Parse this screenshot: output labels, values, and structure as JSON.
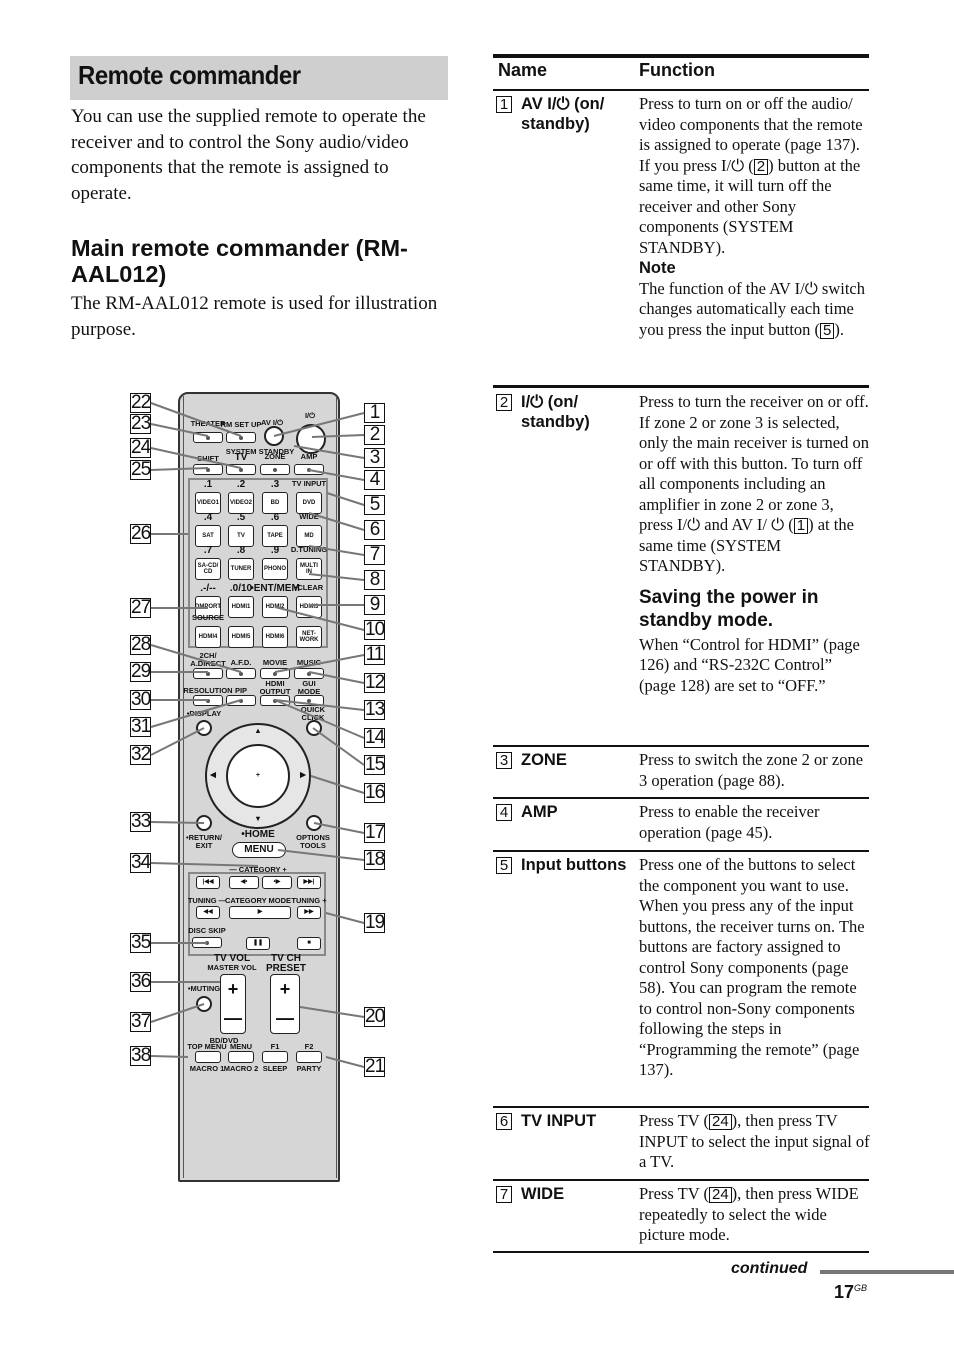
{
  "section_title": "Remote commander",
  "intro": "You can use the supplied remote to operate the receiver and to control the Sony audio/video components that the remote is assigned to operate.",
  "subheading": "Main remote commander (RM-AAL012)",
  "subtext": "The RM-AAL012 remote is used for illustration purpose.",
  "remote": {
    "labels": {
      "theater": "THEATER",
      "rm_set_up": "RM SET UP",
      "av_power": "AV I/⏻",
      "power": "I/⏻",
      "system_standby": "SYSTEM STANDBY",
      "shift": "SHIFT",
      "tv": "TV",
      "zone": "ZONE",
      "amp": "AMP",
      "n1": ".1",
      "n2": ".2",
      "n3": ".3",
      "tv_input": "TV INPUT",
      "n4": ".4",
      "n5": ".5",
      "n6": ".6",
      "wide": "WIDE",
      "n7": ".7",
      "n8": ".8",
      "n9": ".9",
      "d_tuning": "D.TUNING",
      "dash": ".-/--",
      "n0": ".0/10",
      "ent_mem": "•ENT/MEM",
      "clear": "•CLEAR",
      "source": "SOURCE",
      "two_ch": "2CH/\nA.DIRECT",
      "afd": "A.F.D.",
      "movie": "MOVIE",
      "music": "MUSIC",
      "resolution": "RESOLUTION",
      "pip": "PIP",
      "hdmi_output": "HDMI\nOUTPUT",
      "gui_mode": "GUI\nMODE",
      "display": "•DISPLAY",
      "quick_click": "QUICK\nCLICK",
      "return_exit": "•RETURN/\nEXIT",
      "home": "•HOME",
      "menu": "MENU",
      "options_tools": "OPTIONS\nTOOLS",
      "category": "— CATEGORY +",
      "tuning_minus": "TUNING —",
      "category_mode": "CATEGORY MODE",
      "tuning_plus": "TUNING +",
      "disc_skip": "DISC SKIP",
      "tv_vol": "TV VOL",
      "master_vol": "MASTER VOL",
      "tv_ch": "TV CH",
      "preset": "PRESET",
      "muting": "•MUTING",
      "bd_dvd": "BD/DVD",
      "top_menu": "TOP MENU",
      "menu2": "MENU",
      "f1": "F1",
      "f2": "F2",
      "macro1": "MACRO 1",
      "macro2": "MACRO 2",
      "sleep": "SLEEP",
      "party": "PARTY",
      "plus": "+",
      "minus": "—"
    },
    "input_buttons": [
      "VIDEO1",
      "VIDEO2",
      "BD",
      "DVD",
      "SAT",
      "TV",
      "TAPE",
      "MD",
      "SA-CD/\nCD",
      "TUNER",
      "PHONO",
      "MULTI\nIN",
      "DMPORT",
      "HDMI1",
      "HDMI2",
      "HDMI3",
      "HDMI4",
      "HDMI5",
      "HDMI6",
      "NET-\nWORK"
    ],
    "transport": [
      "|◀◀",
      "◀•",
      "•▶",
      "▶▶|",
      "◀◀",
      "▶",
      "▶▶",
      "❚❚",
      "■"
    ],
    "callouts_right": [
      "1",
      "2",
      "3",
      "4",
      "5",
      "6",
      "7",
      "8",
      "9",
      "10",
      "11",
      "12",
      "13",
      "14",
      "15",
      "16",
      "17",
      "18",
      "19",
      "20",
      "21"
    ],
    "callouts_left": [
      "22",
      "23",
      "24",
      "25",
      "26",
      "27",
      "28",
      "29",
      "30",
      "31",
      "32",
      "33",
      "34",
      "35",
      "36",
      "37",
      "38"
    ]
  },
  "table": {
    "headers": {
      "name": "Name",
      "function": "Function"
    },
    "rows": [
      {
        "num": "1",
        "name": "AV I/⏻ (on/ standby)",
        "p1": "Press to turn on or off the audio/ video components that the remote is assigned to operate (page 137).",
        "p2a": "If you press I/⏻ (",
        "p2ref": "2",
        "p2b": ") button at the same time, it will turn off the receiver and other Sony components (SYSTEM STANDBY).",
        "note_label": "Note",
        "p3a": "The function of the AV I/⏻ switch changes automatically each time you press the input button (",
        "p3ref": "5",
        "p3b": ")."
      },
      {
        "num": "2",
        "name": "I/⏻ (on/ standby)",
        "p1": "Press to turn the receiver on or off.",
        "p2a": "If zone 2 or zone 3 is selected, only the main receiver is turned on or off with this button. To turn off all components including an amplifier in zone 2 or zone 3, press I/⏻ and AV I/ ⏻ (",
        "p2ref": "1",
        "p2b": ") at the same time (SYSTEM STANDBY).",
        "subhead": "Saving the power in standby mode.",
        "p3": "When “Control for HDMI” (page 126) and “RS-232C Control” (page 128) are set to “OFF.”"
      },
      {
        "num": "3",
        "name": "ZONE",
        "p1": "Press to switch the zone 2 or zone 3 operation (page 88)."
      },
      {
        "num": "4",
        "name": "AMP",
        "p1": "Press to enable the receiver operation (page 45)."
      },
      {
        "num": "5",
        "name": "Input buttons",
        "p1": "Press one of the buttons to select the component you want to use. When you press any of the input buttons, the receiver turns on. The buttons are factory assigned to control Sony components (page 58). You can program the remote to control non-Sony components following the steps in “Programming the remote” (page 137)."
      },
      {
        "num": "6",
        "name": "TV INPUT",
        "p1a": "Press TV (",
        "p1ref": "24",
        "p1b": "), then press TV INPUT to select the input signal of a TV."
      },
      {
        "num": "7",
        "name": "WIDE",
        "p1a": "Press TV (",
        "p1ref": "24",
        "p1b": "), then press WIDE repeatedly to select the wide picture mode."
      }
    ]
  },
  "footer": {
    "continued": "continued",
    "page": "17",
    "page_suffix": "GB"
  }
}
